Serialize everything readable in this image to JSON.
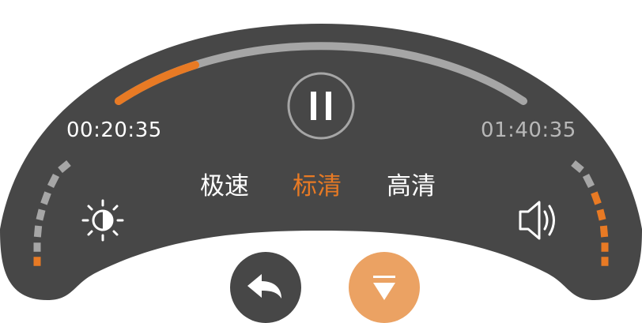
{
  "time": {
    "elapsed": "00:20:35",
    "total": "01:40:35"
  },
  "playback": {
    "state": "paused-icon-shown",
    "progress_fraction": 0.2
  },
  "quality": {
    "options": [
      "极速",
      "标清",
      "高清"
    ],
    "selected_index": 1
  },
  "brightness": {
    "level_fraction": 0.17
  },
  "volume": {
    "level_fraction": 0.67
  },
  "colors": {
    "panel": "#474747",
    "accent": "#e87a24",
    "accent_soft": "#eba263",
    "track": "#a6a6a6",
    "text": "#ffffff",
    "text_muted": "#b8b8b8"
  },
  "icons": {
    "play_pause": "pause-icon",
    "brightness": "sun-icon",
    "volume": "speaker-icon",
    "back": "back-arrow-icon",
    "hide": "collapse-down-icon"
  }
}
